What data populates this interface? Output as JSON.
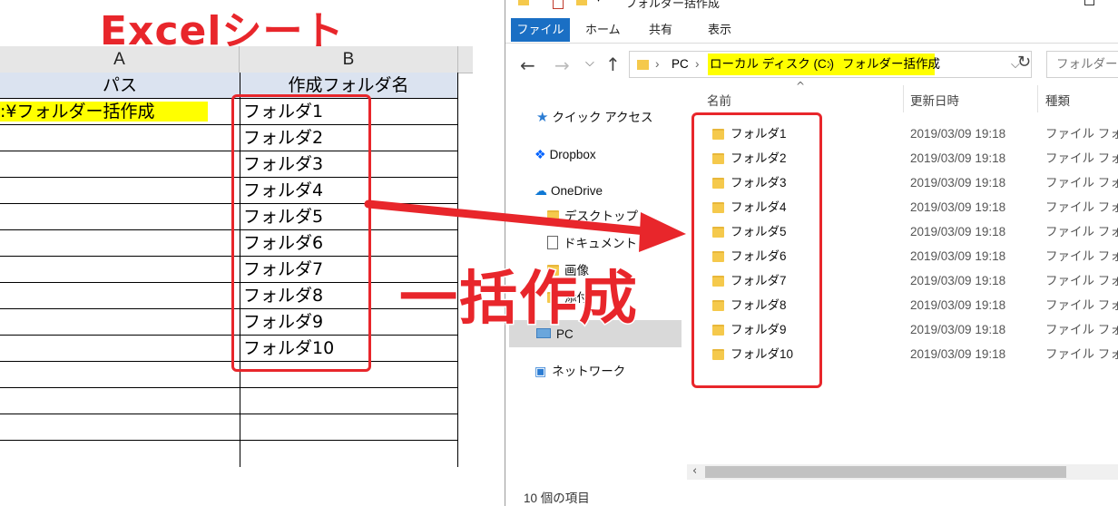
{
  "overlay": {
    "excel_title": "Excelシート",
    "bulk_label": "一括作成",
    "accent_red": "#e8262b",
    "highlight_yellow": "#ffff00"
  },
  "excel": {
    "column_headers": [
      "A",
      "B"
    ],
    "header_row": {
      "a": "パス",
      "b": "作成フォルダ名"
    },
    "path_value": ":¥フォルダー括作成",
    "folder_names": [
      "フォルダ1",
      "フォルダ2",
      "フォルダ3",
      "フォルダ4",
      "フォルダ5",
      "フォルダ6",
      "フォルダ7",
      "フォルダ8",
      "フォルダ9",
      "フォルダ10"
    ]
  },
  "explorer": {
    "title": "フォルダー括作成",
    "ribbon_tabs": [
      "ファイル",
      "ホーム",
      "共有",
      "表示"
    ],
    "address": {
      "root": "PC",
      "drive": "ローカル ディスク (C:)",
      "folder": "フォルダー括作成"
    },
    "search_placeholder": "フォルダー...",
    "nav_items": [
      "クイック アクセス",
      "Dropbox",
      "OneDrive",
      "デスクトップ",
      "ドキュメント",
      "画像",
      "添付",
      "PC",
      "ネットワーク"
    ],
    "columns": {
      "name": "名前",
      "date": "更新日時",
      "type": "種類"
    },
    "files": [
      {
        "name": "フォルダ1",
        "date": "2019/03/09 19:18",
        "type": "ファイル フォルダー"
      },
      {
        "name": "フォルダ2",
        "date": "2019/03/09 19:18",
        "type": "ファイル フォルダー"
      },
      {
        "name": "フォルダ3",
        "date": "2019/03/09 19:18",
        "type": "ファイル フォルダー"
      },
      {
        "name": "フォルダ4",
        "date": "2019/03/09 19:18",
        "type": "ファイル フォルダー"
      },
      {
        "name": "フォルダ5",
        "date": "2019/03/09 19:18",
        "type": "ファイル フォルダー"
      },
      {
        "name": "フォルダ6",
        "date": "2019/03/09 19:18",
        "type": "ファイル フォルダー"
      },
      {
        "name": "フォルダ7",
        "date": "2019/03/09 19:18",
        "type": "ファイル フォルダー"
      },
      {
        "name": "フォルダ8",
        "date": "2019/03/09 19:18",
        "type": "ファイル フォルダー"
      },
      {
        "name": "フォルダ9",
        "date": "2019/03/09 19:18",
        "type": "ファイル フォルダー"
      },
      {
        "name": "フォルダ10",
        "date": "2019/03/09 19:18",
        "type": "ファイル フォルダー"
      }
    ],
    "status": "10 個の項目"
  }
}
